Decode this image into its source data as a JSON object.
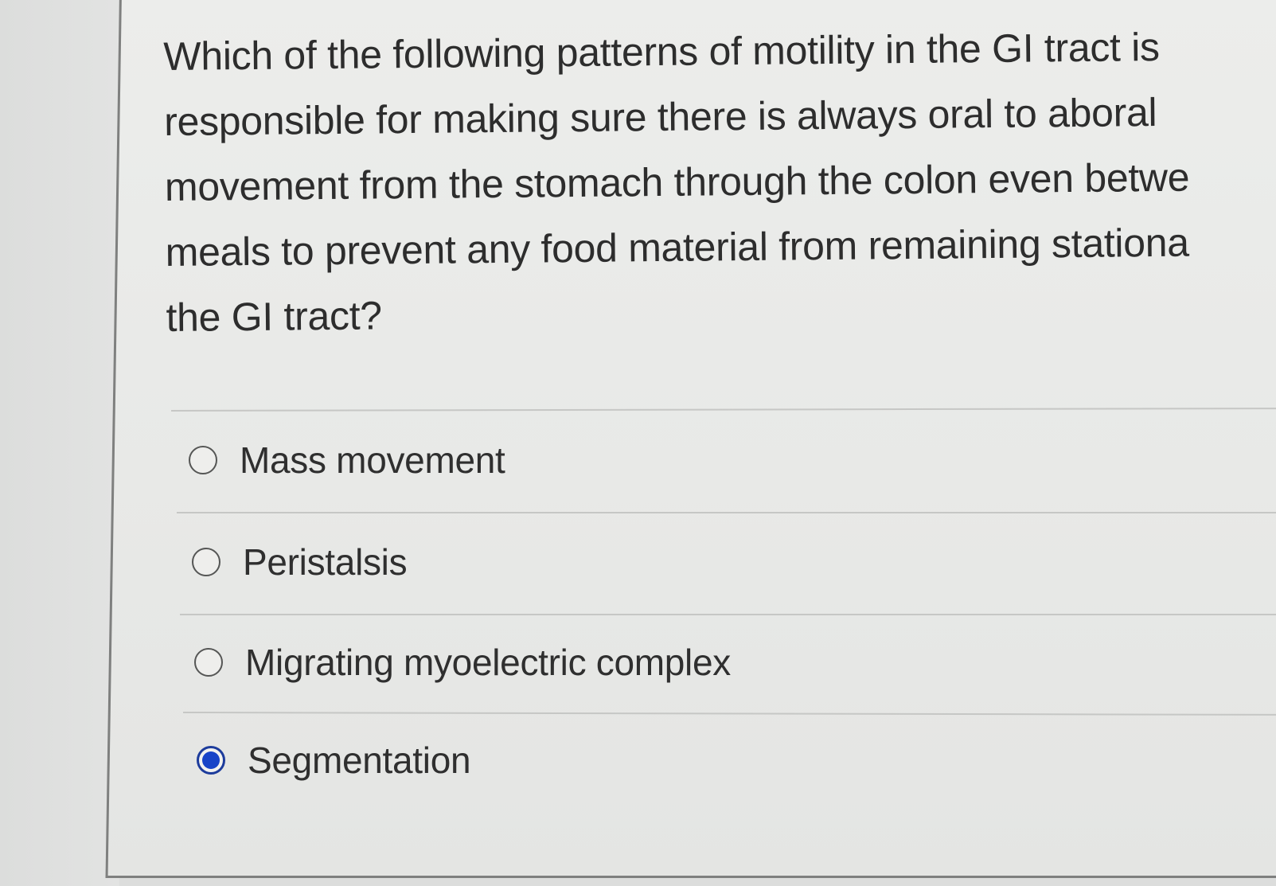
{
  "question": {
    "text": "Which of the following patterns of motility in the GI tract is\nresponsible for making sure there is always oral to aboral\nmovement from the stomach through the colon even betwe\nmeals to prevent any food material from remaining stationa\nthe GI tract?"
  },
  "answers": [
    {
      "label": "Mass movement",
      "selected": false
    },
    {
      "label": "Peristalsis",
      "selected": false
    },
    {
      "label": "Migrating myoelectric complex",
      "selected": false
    },
    {
      "label": "Segmentation",
      "selected": true
    }
  ],
  "colors": {
    "selected_radio": "#1844c8",
    "text": "#2d2d2d",
    "background": "#e6e7e6"
  }
}
